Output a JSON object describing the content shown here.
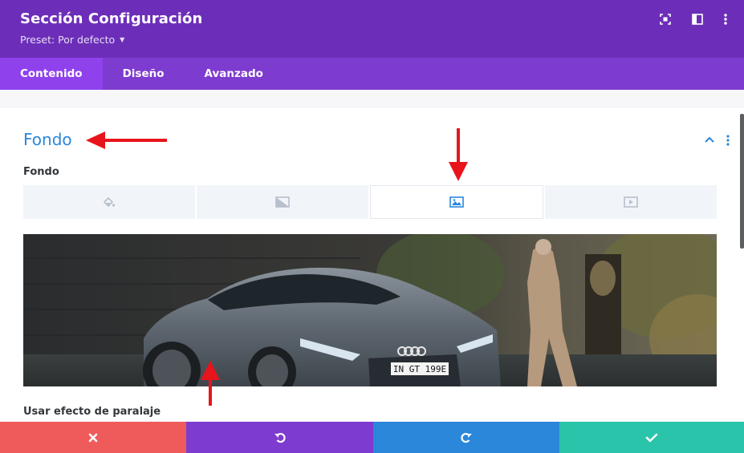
{
  "header": {
    "title": "Sección Configuración",
    "preset_label": "Preset: Por defecto",
    "icons": [
      "expand-icon",
      "split-view-icon",
      "more-vertical-icon"
    ]
  },
  "tabs": [
    {
      "label": "Contenido",
      "active": true
    },
    {
      "label": "Diseño",
      "active": false
    },
    {
      "label": "Avanzado",
      "active": false
    }
  ],
  "section": {
    "title": "Fondo",
    "field_label": "Fondo",
    "background_types": [
      {
        "icon": "paint-bucket-icon",
        "active": false
      },
      {
        "icon": "gradient-icon",
        "active": false
      },
      {
        "icon": "image-icon",
        "active": true
      },
      {
        "icon": "video-icon",
        "active": false
      }
    ],
    "plate_text": "IN GT 199E",
    "next_field_label": "Usar efecto de paralaje"
  },
  "footer": {
    "buttons": [
      "cancel-icon",
      "undo-icon",
      "redo-icon",
      "save-icon"
    ]
  },
  "colors": {
    "header": "#6c2eb9",
    "tabs_bar": "#7e3bd0",
    "tab_active": "#8f42ec",
    "accent_blue": "#2b87da",
    "cancel": "#ef5b5b",
    "undo": "#7e3bd0",
    "redo": "#2b87da",
    "save": "#29c4a9",
    "annotation_arrow": "#e8141b"
  }
}
